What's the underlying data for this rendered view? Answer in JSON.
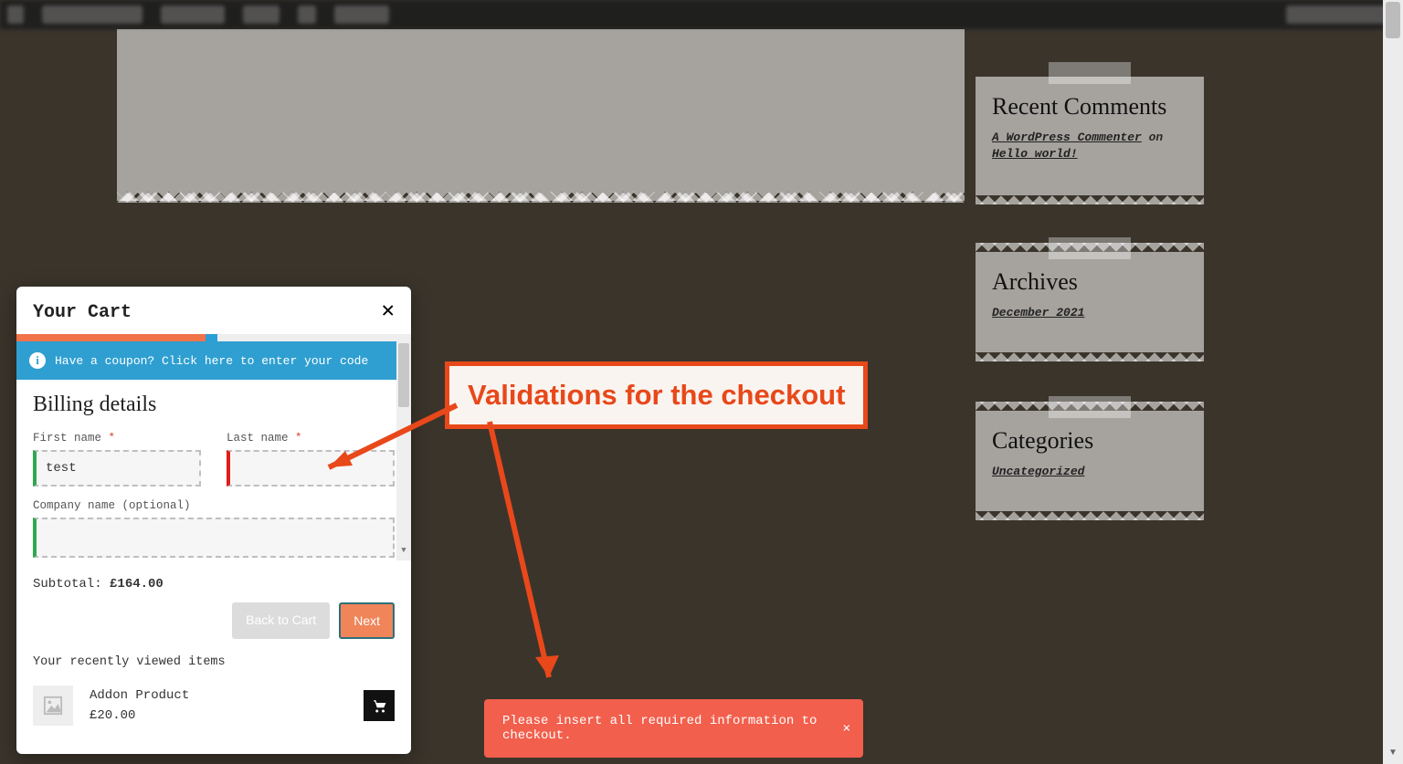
{
  "sidebar": {
    "recentComments": {
      "title": "Recent Comments",
      "author": "A WordPress Commenter",
      "on": " on ",
      "post": "Hello world!"
    },
    "archives": {
      "title": "Archives",
      "item": "December 2021"
    },
    "categories": {
      "title": "Categories",
      "item": "Uncategorized"
    }
  },
  "cart": {
    "title": "Your Cart",
    "coupon": "Have a coupon? Click here to enter your code",
    "billingHeading": "Billing details",
    "fields": {
      "firstNameLabel": "First name ",
      "firstNameValue": "test",
      "lastNameLabel": "Last name ",
      "lastNameValue": "",
      "companyLabel": "Company name (optional)",
      "companyValue": ""
    },
    "required": "*",
    "subtotalLabel": "Subtotal: ",
    "subtotalValue": "£164.00",
    "backBtn": "Back to Cart",
    "nextBtn": "Next",
    "recentLabel": "Your recently viewed items",
    "recentItem": {
      "name": "Addon Product",
      "price": "£20.00"
    }
  },
  "annotation": {
    "label": "Validations for the checkout"
  },
  "toast": {
    "message": "Please insert all required information to checkout."
  }
}
